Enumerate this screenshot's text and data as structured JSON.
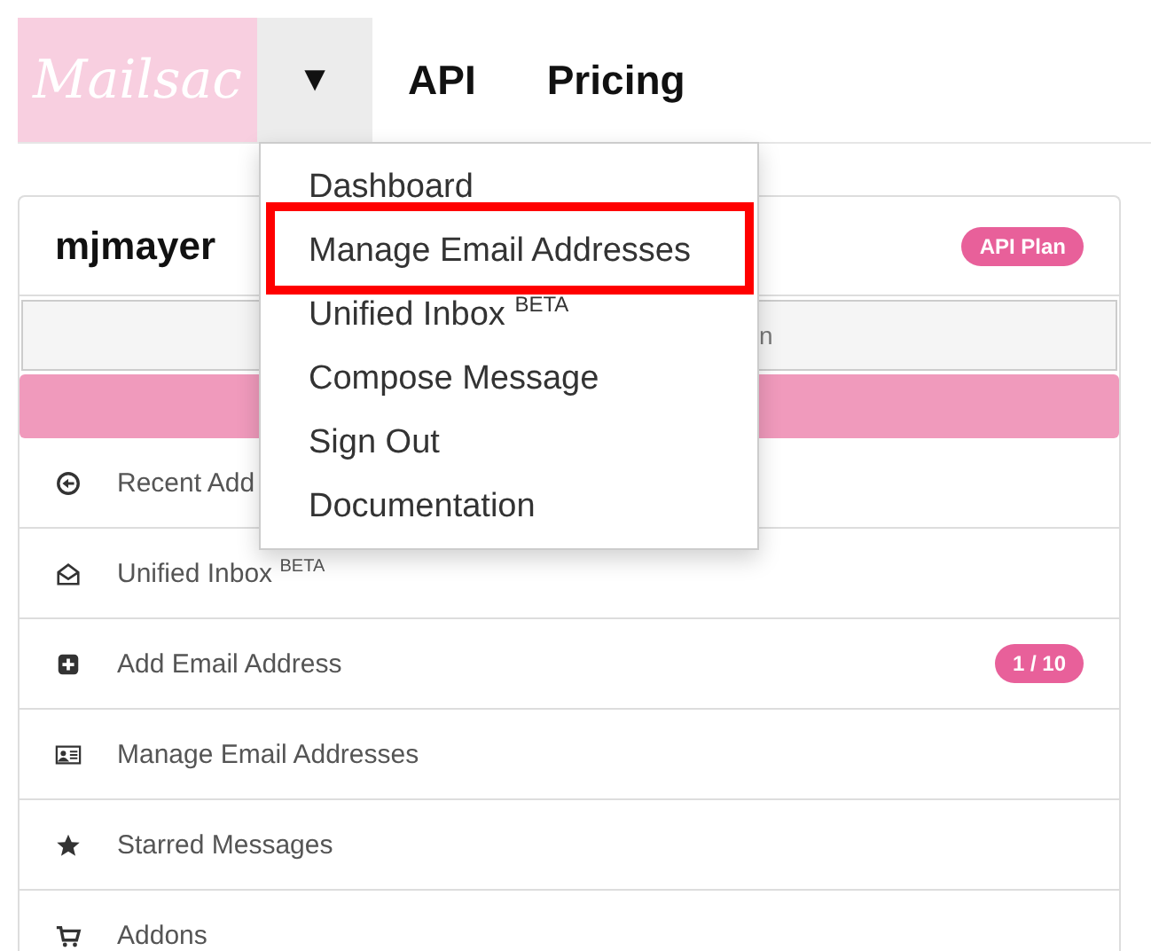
{
  "logo": {
    "text": "Mailsac"
  },
  "nav": {
    "toggle": "▼",
    "links": [
      "API",
      "Pricing"
    ]
  },
  "menu": {
    "items": [
      {
        "label": "Dashboard",
        "highlighted": false
      },
      {
        "label": "Manage Email Addresses",
        "highlighted": true
      },
      {
        "label": "Unified Inbox $^{BETA}$",
        "highlighted": false
      },
      {
        "label": "Compose Message",
        "highlighted": false
      },
      {
        "label": "Sign Out",
        "highlighted": false
      },
      {
        "label": "Documentation",
        "highlighted": false
      }
    ]
  },
  "account": {
    "username": "mjmayer",
    "plan_badge": "API Plan",
    "field_text": "n",
    "items": [
      {
        "kind": "recent",
        "label": "Recent Add"
      },
      {
        "kind": "inbox",
        "label": "Unified Inbox $^{BETA}$"
      },
      {
        "kind": "add",
        "label": "Add Email Address",
        "badge": "1 / 10"
      },
      {
        "kind": "manage",
        "label": "Manage Email Addresses"
      },
      {
        "kind": "starred",
        "label": "Starred Messages"
      },
      {
        "kind": "addons",
        "label": "Addons"
      }
    ]
  }
}
